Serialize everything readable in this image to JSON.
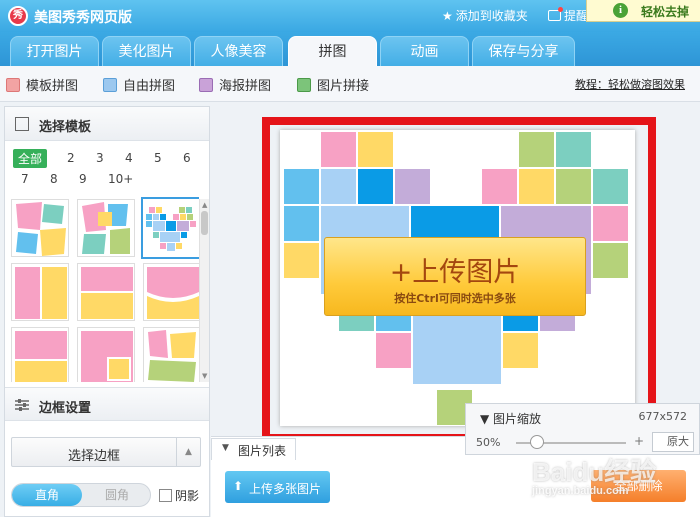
{
  "app": {
    "logo_text": "秀",
    "title": "美图秀秀网页版",
    "add_favorite": "添加到收藏夹",
    "remind": "提醒",
    "tip_banner": "轻松去掉"
  },
  "main_tabs": [
    {
      "label": "打开图片"
    },
    {
      "label": "美化图片"
    },
    {
      "label": "人像美容"
    },
    {
      "label": "拼图"
    },
    {
      "label": "动画"
    },
    {
      "label": "保存与分享"
    }
  ],
  "sub_tools": [
    {
      "label": "模板拼图"
    },
    {
      "label": "自由拼图"
    },
    {
      "label": "海报拼图"
    },
    {
      "label": "图片拼接"
    }
  ],
  "tutorial_link": "教程：轻松做溶图效果",
  "left_panel": {
    "template_title": "选择模板",
    "filters": [
      "全部",
      "2",
      "3",
      "4",
      "5",
      "6",
      "7",
      "8",
      "9",
      "10+"
    ],
    "border_title": "边框设置",
    "select_border": "选择边框",
    "corner_options": [
      "直角",
      "圆角"
    ],
    "shadow_label": "阴影"
  },
  "upload": {
    "main": "+上传图片",
    "sub": "按住Ctrl可同时选中多张"
  },
  "zoom": {
    "title": "图片缩放",
    "size": "677x572",
    "percent": "50%",
    "plus": "+",
    "button": "原大"
  },
  "list": {
    "tab_label": "图片列表",
    "upload_multi": "上传多张图片",
    "clear_all": "全部删除"
  },
  "watermark": {
    "text": "Baidu经验",
    "url": "jingyan.baidu.com"
  },
  "colors": {
    "pink": "#f7a1c4",
    "yellow": "#ffd966",
    "blue": "#62c0ee",
    "deepblue": "#0a9be6",
    "lightblue": "#a8d1f5",
    "purple": "#c3acd9",
    "green": "#b5d27a",
    "teal": "#7ccfc0",
    "highlight": "#e51419"
  }
}
